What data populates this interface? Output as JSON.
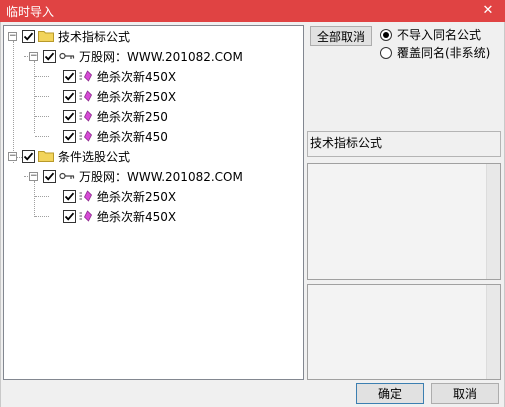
{
  "window": {
    "title": "临时导入",
    "close_glyph": "✕"
  },
  "tree": {
    "nodes": [
      {
        "label": "技术指标公式",
        "type": "folder",
        "checked": true,
        "expanded": true
      },
      {
        "label": "万股网：WWW.201082.COM",
        "type": "key",
        "checked": true,
        "expanded": true
      },
      {
        "label": "绝杀次新450X",
        "type": "formula",
        "checked": true
      },
      {
        "label": "绝杀次新250X",
        "type": "formula",
        "checked": true
      },
      {
        "label": "绝杀次新250",
        "type": "formula",
        "checked": true
      },
      {
        "label": "绝杀次新450",
        "type": "formula",
        "checked": true
      },
      {
        "label": "条件选股公式",
        "type": "folder",
        "checked": true,
        "expanded": true
      },
      {
        "label": "万股网：WWW.201082.COM",
        "type": "key",
        "checked": true,
        "expanded": true
      },
      {
        "label": "绝杀次新250X",
        "type": "formula",
        "checked": true
      },
      {
        "label": "绝杀次新450X",
        "type": "formula",
        "checked": true
      }
    ]
  },
  "controls": {
    "clear_all_label": "全部取消",
    "radio_no_import_label": "不导入同名公式",
    "radio_overwrite_label": "覆盖同名(非系统)",
    "selected_option": "no_import",
    "info_text": "技术指标公式",
    "ok_label": "确定",
    "cancel_label": "取消"
  },
  "colors": {
    "titlebar": "#e04343",
    "folder": "#f2d45c",
    "formula_icon": "#d64bd6"
  }
}
